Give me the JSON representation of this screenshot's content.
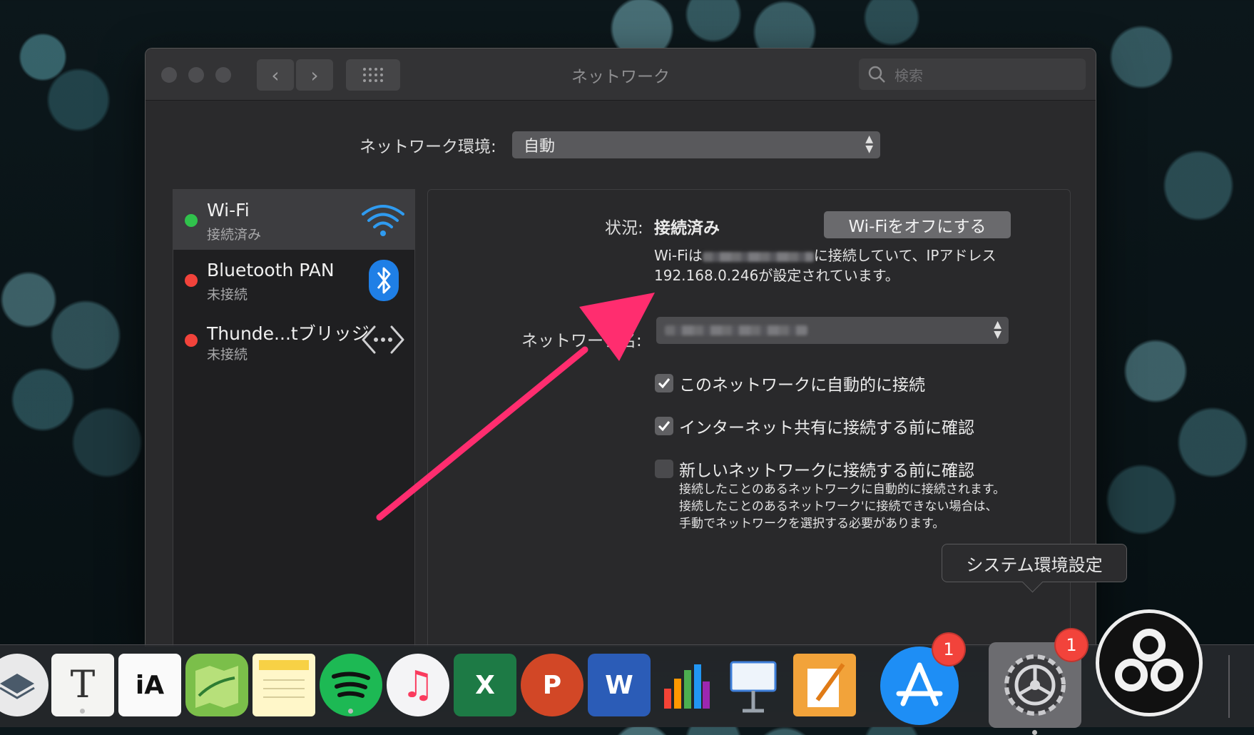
{
  "window": {
    "title": "ネットワーク",
    "search_placeholder": "検索"
  },
  "location": {
    "label": "ネットワーク環境:",
    "value": "自動"
  },
  "services": [
    {
      "name": "Wi-Fi",
      "status": "接続済み",
      "dot_color": "#30c24c",
      "selected": true,
      "icon": "wifi-icon"
    },
    {
      "name": "Bluetooth PAN",
      "status": "未接続",
      "dot_color": "#f2433b",
      "selected": false,
      "icon": "bluetooth-icon"
    },
    {
      "name": "Thunde...tブリッジ",
      "status": "未接続",
      "dot_color": "#f2433b",
      "selected": false,
      "icon": "thunderbolt-bridge-icon"
    }
  ],
  "detail": {
    "status_label": "状況:",
    "status_value": "接続済み",
    "wifi_off_button": "Wi-Fiをオフにする",
    "desc_prefix": "Wi-Fiは",
    "desc_mid": "に接続していて、IPアドレス",
    "ip_address": "192.168.0.246",
    "desc_suffix": "が設定されています。",
    "network_name_label": "ネットワーク名:",
    "checkboxes": [
      {
        "label": "このネットワークに自動的に接続",
        "checked": true
      },
      {
        "label": "インターネット共有に接続する前に確認",
        "checked": true
      },
      {
        "label": "新しいネットワークに接続する前に確認",
        "checked": false
      }
    ],
    "note": "接続したことのあるネットワークに自動的に接続されます。接続したことのあるネットワーク'に接続できない場合は、手動でネットワークを選択する必要があります。"
  },
  "tooltip": "システム環境設定",
  "dock": {
    "apps": [
      {
        "name": "layers-app-icon"
      },
      {
        "name": "typora-icon",
        "glyph": "T"
      },
      {
        "name": "ia-writer-icon",
        "glyph": "iA"
      },
      {
        "name": "maps-icon"
      },
      {
        "name": "notes-icon"
      },
      {
        "name": "spotify-icon"
      },
      {
        "name": "music-icon",
        "glyph": "♫"
      },
      {
        "name": "excel-icon",
        "glyph": "X"
      },
      {
        "name": "powerpoint-icon",
        "glyph": "P"
      },
      {
        "name": "word-icon",
        "glyph": "W"
      },
      {
        "name": "numbers-icon"
      },
      {
        "name": "keynote-icon"
      },
      {
        "name": "pages-icon"
      },
      {
        "name": "app-store-icon",
        "badge": "1"
      },
      {
        "name": "system-preferences-icon",
        "badge": "1"
      },
      {
        "name": "obs-icon"
      }
    ]
  },
  "colors": {
    "annotation_arrow": "#ff2d6f",
    "connected": "#30c24c",
    "disconnected": "#f2433b"
  }
}
